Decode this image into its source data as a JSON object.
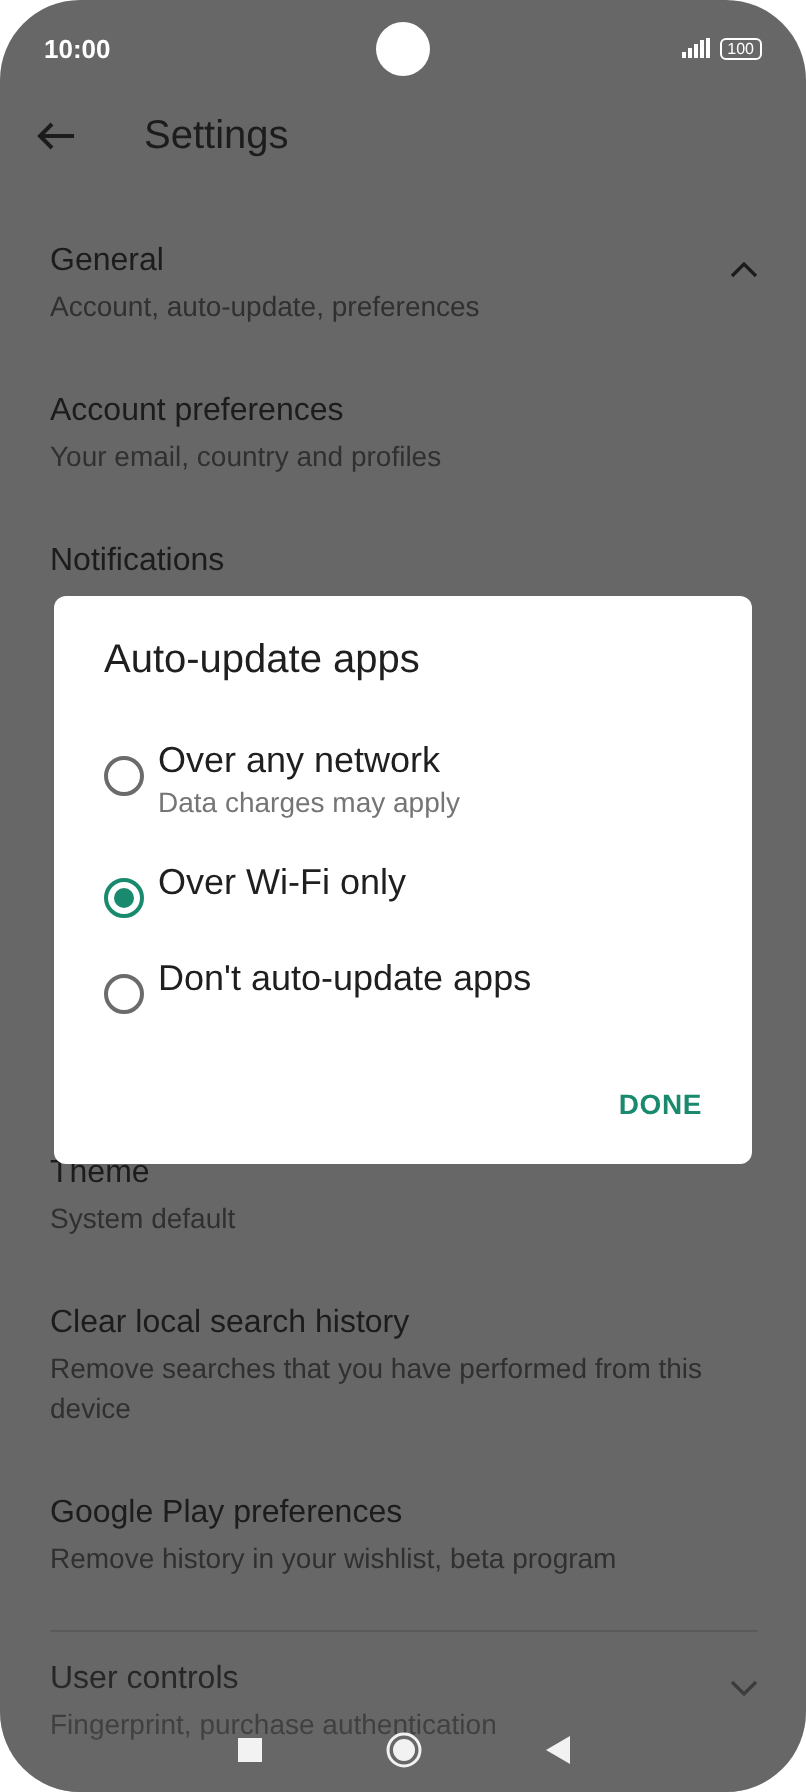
{
  "status_bar": {
    "time": "10:00",
    "battery": "100"
  },
  "toolbar": {
    "title": "Settings"
  },
  "settings": {
    "items": [
      {
        "title": "General",
        "subtitle": "Account, auto-update, preferences",
        "expanded": true
      },
      {
        "title": "Account preferences",
        "subtitle": "Your email, country and profiles"
      },
      {
        "title": "Notifications"
      },
      {
        "title": "Theme",
        "subtitle": "System default"
      },
      {
        "title": "Clear local search history",
        "subtitle": "Remove searches that you have performed from this device"
      },
      {
        "title": "Google Play preferences",
        "subtitle": "Remove history in your wishlist, beta program"
      },
      {
        "title": "User controls",
        "subtitle": "Fingerprint, purchase authentication",
        "expanded": false
      }
    ]
  },
  "dialog": {
    "title": "Auto-update apps",
    "options": [
      {
        "label": "Over any network",
        "hint": "Data charges may apply",
        "selected": false
      },
      {
        "label": "Over Wi-Fi only",
        "selected": true
      },
      {
        "label": "Don't auto-update apps",
        "selected": false
      }
    ],
    "button": "DONE"
  }
}
